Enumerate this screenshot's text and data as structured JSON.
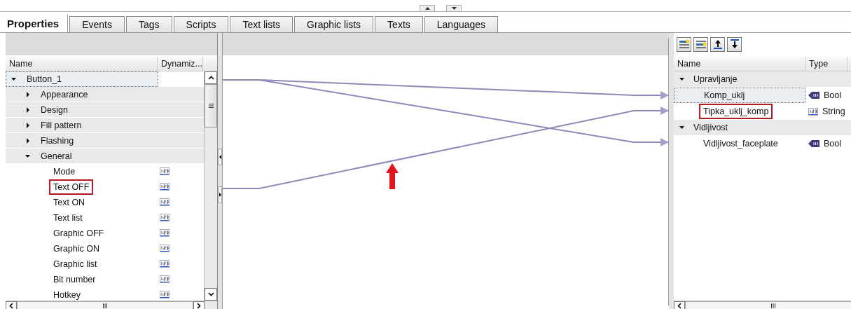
{
  "tabs": [
    {
      "label": "Properties",
      "selected": true
    },
    {
      "label": "Events",
      "selected": false
    },
    {
      "label": "Tags",
      "selected": false
    },
    {
      "label": "Scripts",
      "selected": false
    },
    {
      "label": "Text lists",
      "selected": false
    },
    {
      "label": "Graphic lists",
      "selected": false
    },
    {
      "label": "Texts",
      "selected": false
    },
    {
      "label": "Languages",
      "selected": false
    }
  ],
  "properties": {
    "columns": [
      "Name",
      "Dynamiz..."
    ],
    "tree": [
      {
        "label": "Button_1",
        "expanded": true,
        "selected": true,
        "children": [
          {
            "label": "Appearance",
            "expanded": false
          },
          {
            "label": "Design",
            "expanded": false
          },
          {
            "label": "Fill pattern",
            "expanded": false
          },
          {
            "label": "Flashing",
            "expanded": false
          },
          {
            "label": "General",
            "expanded": true,
            "children": [
              {
                "label": "Mode",
                "highlighted": false
              },
              {
                "label": "Text OFF",
                "highlighted": true
              },
              {
                "label": "Text ON",
                "highlighted": false
              },
              {
                "label": "Text list",
                "highlighted": false
              },
              {
                "label": "Graphic OFF",
                "highlighted": false
              },
              {
                "label": "Graphic ON",
                "highlighted": false
              },
              {
                "label": "Graphic list",
                "highlighted": false
              },
              {
                "label": "Bit number",
                "highlighted": false
              },
              {
                "label": "Hotkey",
                "highlighted": false
              }
            ]
          }
        ]
      }
    ]
  },
  "interface": {
    "columns": [
      "Name",
      "Type"
    ],
    "tree": [
      {
        "label": "Upravljanje",
        "expanded": true,
        "children": [
          {
            "name": "Komp_uklj",
            "type": "Bool",
            "kind": "bool",
            "selected": true,
            "highlighted": false
          },
          {
            "name": "Tipka_uklj_komp",
            "type": "String",
            "kind": "number",
            "selected": false,
            "highlighted": true
          }
        ]
      },
      {
        "label": "Vidljivost",
        "expanded": true,
        "children": [
          {
            "name": "Vidljivost_faceplate",
            "type": "Bool",
            "kind": "bool",
            "selected": false,
            "highlighted": false
          }
        ]
      }
    ]
  }
}
